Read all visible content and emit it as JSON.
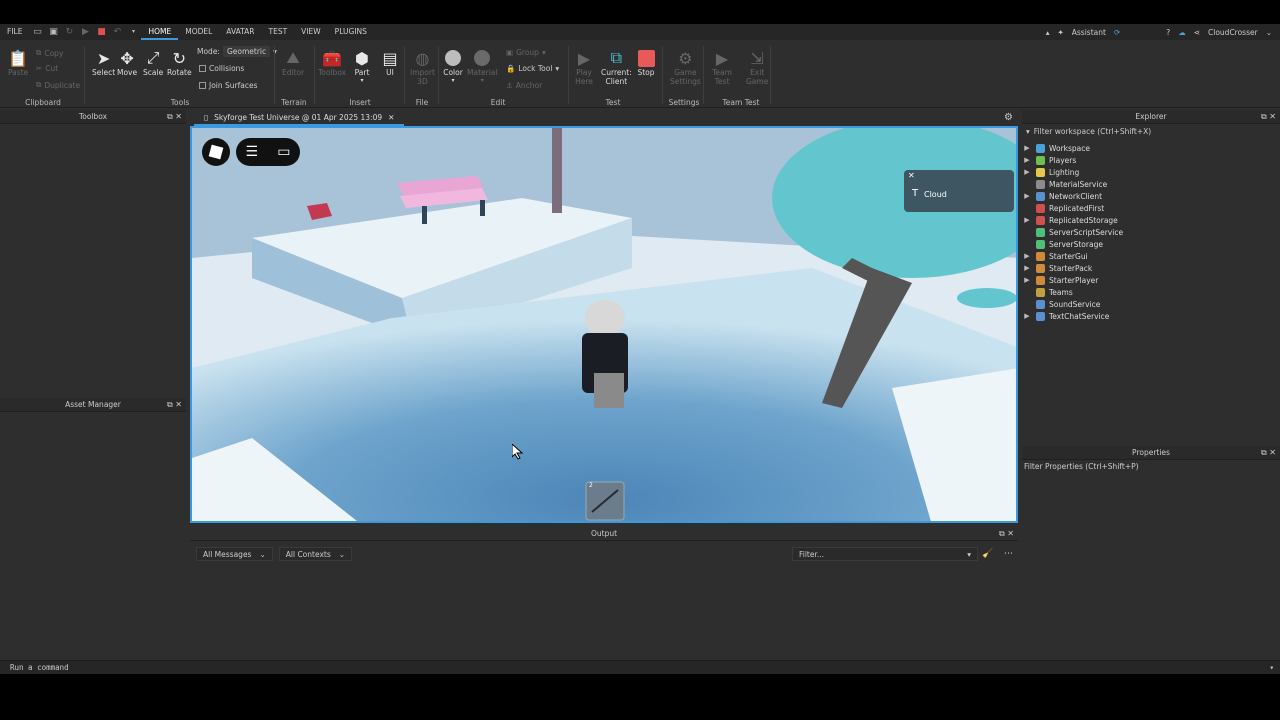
{
  "menubar": {
    "items": [
      "FILE",
      "HOME",
      "MODEL",
      "AVATAR",
      "TEST",
      "VIEW",
      "PLUGINS"
    ],
    "active": "HOME",
    "assistant": "Assistant",
    "user": "CloudCrosser"
  },
  "ribbon": {
    "clipboard": {
      "paste": "Paste",
      "copy": "Copy",
      "cut": "Cut",
      "duplicate": "Duplicate",
      "group": "Clipboard"
    },
    "tools": {
      "select": "Select",
      "move": "Move",
      "scale": "Scale",
      "rotate": "Rotate",
      "mode_label": "Mode:",
      "mode_value": "Geometric",
      "collisions": "Collisions",
      "join_surfaces": "Join Surfaces",
      "group": "Tools"
    },
    "terrain": {
      "editor": "Editor",
      "group": "Terrain"
    },
    "insert": {
      "toolbox": "Toolbox",
      "part": "Part",
      "ui": "UI",
      "group": "Insert"
    },
    "file": {
      "import_3d_line1": "Import",
      "import_3d_line2": "3D",
      "group": "File"
    },
    "edit": {
      "color": "Color",
      "material": "Material",
      "group_btn": "Group",
      "lock_tool": "Lock Tool",
      "anchor": "Anchor",
      "group": "Edit"
    },
    "test": {
      "play_here_line1": "Play",
      "play_here_line2": "Here",
      "current_line1": "Current:",
      "current_line2": "Client",
      "stop": "Stop",
      "group": "Test"
    },
    "settings": {
      "game_settings_line1": "Game",
      "game_settings_line2": "Settings",
      "group": "Settings"
    },
    "team_test": {
      "team_test_line1": "Team",
      "team_test_line2": "Test",
      "exit_game_line1": "Exit",
      "exit_game_line2": "Game",
      "group": "Team Test"
    }
  },
  "panels": {
    "toolbox": "Toolbox",
    "asset_manager": "Asset Manager",
    "explorer": "Explorer",
    "explorer_filter": "Filter workspace (Ctrl+Shift+X)",
    "properties": "Properties",
    "properties_filter": "Filter Properties (Ctrl+Shift+P)",
    "output": "Output"
  },
  "tab": {
    "title": "Skyforge Test Universe @ 01 Apr 2025 13:09"
  },
  "explorer_items": [
    {
      "label": "Workspace",
      "color": "#4aa3d8",
      "expandable": true
    },
    {
      "label": "Players",
      "color": "#6fbf4f",
      "expandable": true
    },
    {
      "label": "Lighting",
      "color": "#e6c84a",
      "expandable": true
    },
    {
      "label": "MaterialService",
      "color": "#8c8c8c",
      "expandable": false
    },
    {
      "label": "NetworkClient",
      "color": "#5a8fd0",
      "expandable": true
    },
    {
      "label": "ReplicatedFirst",
      "color": "#d05050",
      "expandable": false
    },
    {
      "label": "ReplicatedStorage",
      "color": "#d05050",
      "expandable": true
    },
    {
      "label": "ServerScriptService",
      "color": "#4fbf7a",
      "expandable": false
    },
    {
      "label": "ServerStorage",
      "color": "#4fbf7a",
      "expandable": false
    },
    {
      "label": "StarterGui",
      "color": "#d08a3a",
      "expandable": true
    },
    {
      "label": "StarterPack",
      "color": "#d08a3a",
      "expandable": true
    },
    {
      "label": "StarterPlayer",
      "color": "#d08a3a",
      "expandable": true
    },
    {
      "label": "Teams",
      "color": "#c0a040",
      "expandable": false
    },
    {
      "label": "SoundService",
      "color": "#5a8fd0",
      "expandable": false
    },
    {
      "label": "TextChatService",
      "color": "#5a8fd0",
      "expandable": true
    }
  ],
  "output": {
    "messages": "All Messages",
    "contexts": "All Contexts",
    "filter_placeholder": "Filter..."
  },
  "game": {
    "cloud_label": "Cloud",
    "hotbar_slot": "2"
  },
  "command_bar": {
    "placeholder": "Run a command"
  }
}
